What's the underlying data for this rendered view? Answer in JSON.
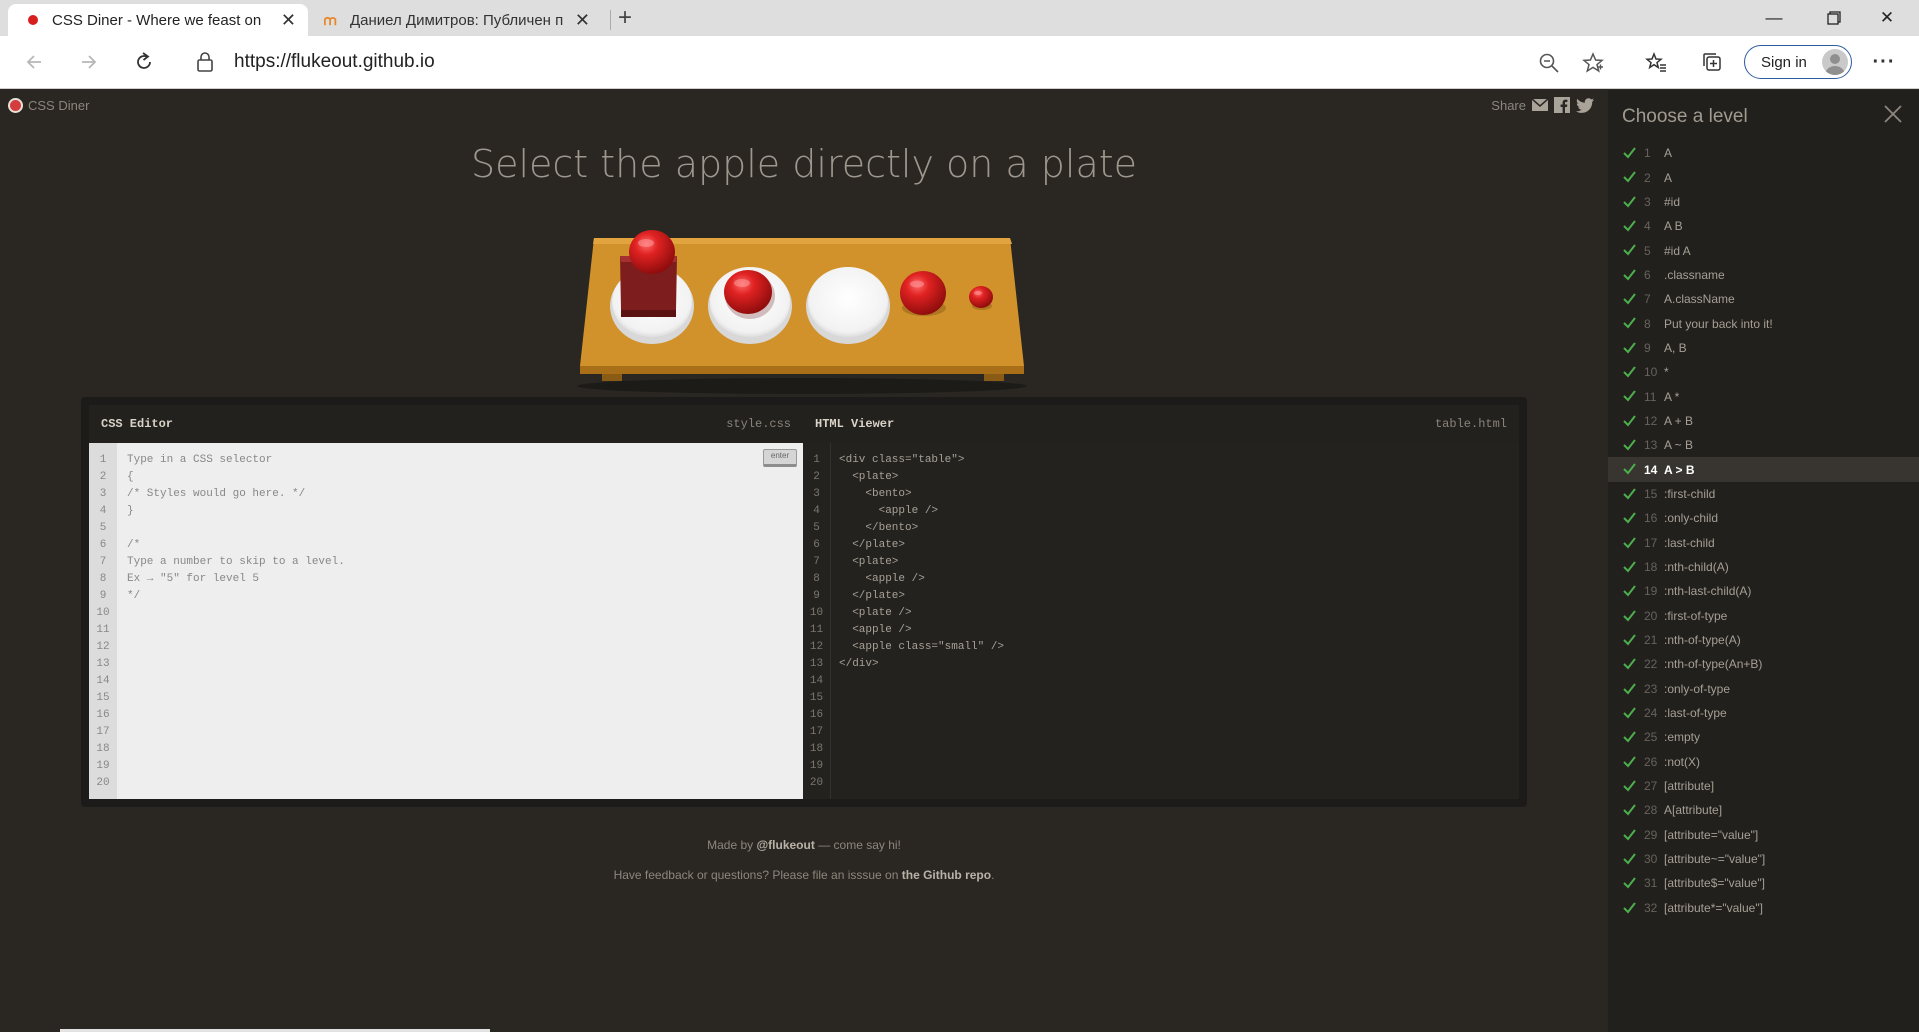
{
  "browser": {
    "tabs": [
      {
        "title": "CSS Diner - Where we feast on C",
        "active": true,
        "favicon": "css-diner-icon"
      },
      {
        "title": "Даниел Димитров: Публичен п",
        "active": false,
        "favicon": "moodle-icon"
      }
    ],
    "url": "https://flukeout.github.io",
    "sign_in_label": "Sign in",
    "more_label": "···"
  },
  "header": {
    "brand": "CSS Diner",
    "share_label": "Share"
  },
  "level": {
    "instruction": "Select the apple directly on a plate"
  },
  "css_editor": {
    "title": "CSS Editor",
    "filename": "style.css",
    "enter_label": "enter",
    "line_numbers": "1\n2\n3\n4\n5\n6\n7\n8\n9\n10\n11\n12\n13\n14\n15\n16\n17\n18\n19\n20",
    "code": "Type in a CSS selector\n{\n/* Styles would go here. */\n}\n\n/*\nType a number to skip to a level.\nEx → \"5\" for level 5\n*/"
  },
  "html_viewer": {
    "title": "HTML Viewer",
    "filename": "table.html",
    "line_numbers": "1\n2\n3\n4\n5\n6\n7\n8\n9\n10\n11\n12\n13\n14\n15\n16\n17\n18\n19\n20",
    "code": "<div class=\"table\">\n  <plate>\n    <bento>\n      <apple />\n    </bento>\n  </plate>\n  <plate>\n    <apple />\n  </plate>\n  <plate />\n  <apple />\n  <apple class=\"small\" />\n</div>"
  },
  "footer": {
    "made_by_prefix": "Made by",
    "made_by_handle": "@flukeout",
    "made_by_suffix": "— come say hi!",
    "feedback_prefix": "Have feedback or questions? Please file an isssue on",
    "feedback_link": "the Github repo",
    "feedback_suffix": "."
  },
  "sidebar": {
    "title": "Choose a level",
    "current_level": 14,
    "levels": [
      {
        "num": "1",
        "name": "A"
      },
      {
        "num": "2",
        "name": "A"
      },
      {
        "num": "3",
        "name": "#id"
      },
      {
        "num": "4",
        "name": "A B"
      },
      {
        "num": "5",
        "name": "#id A"
      },
      {
        "num": "6",
        "name": ".classname"
      },
      {
        "num": "7",
        "name": "A.className"
      },
      {
        "num": "8",
        "name": "Put your back into it!"
      },
      {
        "num": "9",
        "name": "A, B"
      },
      {
        "num": "10",
        "name": "*"
      },
      {
        "num": "11",
        "name": "A *"
      },
      {
        "num": "12",
        "name": "A + B"
      },
      {
        "num": "13",
        "name": "A ~ B"
      },
      {
        "num": "14",
        "name": "A > B"
      },
      {
        "num": "15",
        "name": ":first-child"
      },
      {
        "num": "16",
        "name": ":only-child"
      },
      {
        "num": "17",
        "name": ":last-child"
      },
      {
        "num": "18",
        "name": ":nth-child(A)"
      },
      {
        "num": "19",
        "name": ":nth-last-child(A)"
      },
      {
        "num": "20",
        "name": ":first-of-type"
      },
      {
        "num": "21",
        "name": ":nth-of-type(A)"
      },
      {
        "num": "22",
        "name": ":nth-of-type(An+B)"
      },
      {
        "num": "23",
        "name": ":only-of-type"
      },
      {
        "num": "24",
        "name": ":last-of-type"
      },
      {
        "num": "25",
        "name": ":empty"
      },
      {
        "num": "26",
        "name": ":not(X)"
      },
      {
        "num": "27",
        "name": "[attribute]"
      },
      {
        "num": "28",
        "name": "A[attribute]"
      },
      {
        "num": "29",
        "name": "[attribute=\"value\"]"
      },
      {
        "num": "30",
        "name": "[attribute~=\"value\"]"
      },
      {
        "num": "31",
        "name": "[attribute$=\"value\"]"
      },
      {
        "num": "32",
        "name": "[attribute*=\"value\"]"
      }
    ]
  },
  "colors": {
    "background": "#2a2723",
    "sidebar": "#22201d",
    "check": "#4cae4c",
    "apple": "#d81f1f",
    "table": "#d2922b",
    "accent_link": "#2d5d9f"
  }
}
